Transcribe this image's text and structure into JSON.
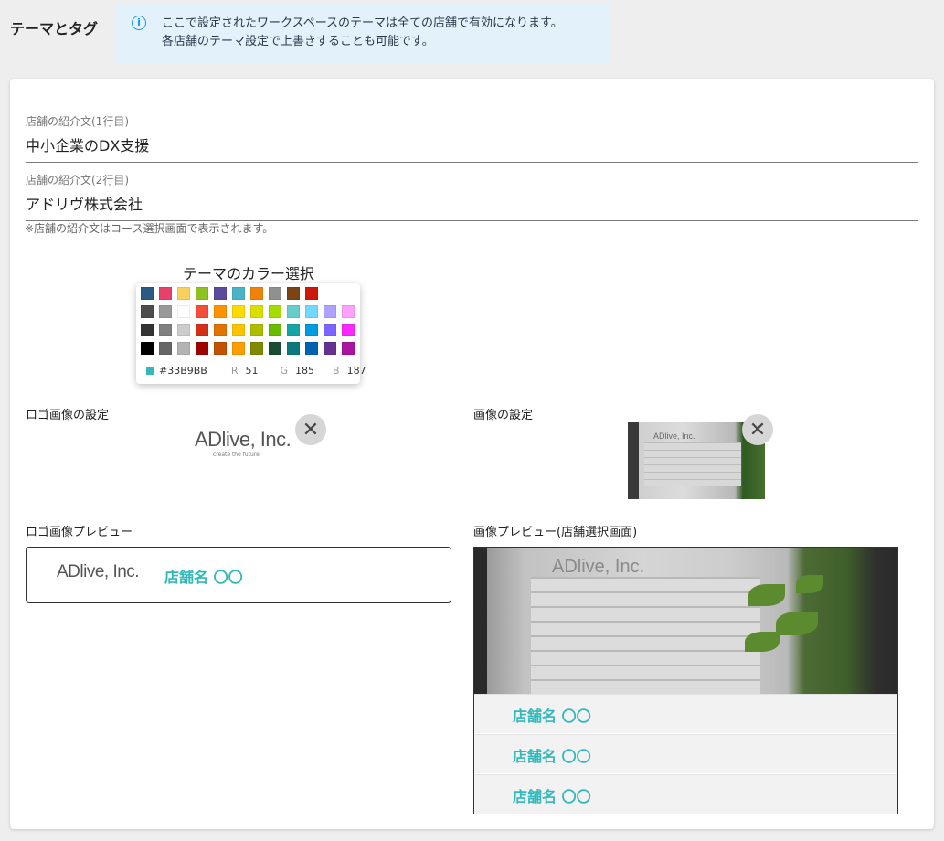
{
  "section": {
    "title": "テーマとタグ"
  },
  "info": {
    "line1": "ここで設定されたワークスペースのテーマは全ての店舗で有効になります。",
    "line2": "各店舗のテーマ設定で上書きすることも可能です。",
    "icon": "info-icon"
  },
  "intro1": {
    "label": "店舗の紹介文(1行目)",
    "value": "中小企業のDX支援"
  },
  "intro2": {
    "label": "店舗の紹介文(2行目)",
    "value": "アドリヴ株式会社"
  },
  "intro_note": "※店舗の紹介文はコース選択画面で表示されます。",
  "theme_color": {
    "title": "テーマのカラー選択",
    "selected_hex": "#33B9BB",
    "r_label": "R",
    "r": "51",
    "g_label": "G",
    "g": "185",
    "b_label": "B",
    "b": "187",
    "palette": [
      [
        "#2a5a84",
        "#e8406c",
        "#f8d15c",
        "#8dc21f",
        "#5c4a9c",
        "#4bb3c8",
        "#f0820a",
        "#909090",
        "#7a4415",
        "#cc1a0a"
      ],
      [
        "#4d4d4d",
        "#999999",
        "#ffffff",
        "#f44e3b",
        "#fe9200",
        "#fcdc00",
        "#dbdf00",
        "#a4dd00",
        "#68ccca",
        "#73d8ff",
        "#aea1ff",
        "#fda1ff"
      ],
      [
        "#333333",
        "#808080",
        "#cccccc",
        "#d33115",
        "#e27300",
        "#fcc400",
        "#b0bc00",
        "#68bc00",
        "#16a5a5",
        "#009ce0",
        "#7b64ff",
        "#fa28ff"
      ],
      [
        "#000000",
        "#666666",
        "#b3b3b3",
        "#9f0500",
        "#c45100",
        "#fb9e00",
        "#808900",
        "#194d33",
        "#0c797d",
        "#0062b1",
        "#653294",
        "#ab149e"
      ]
    ]
  },
  "logo_setting": {
    "label": "ロゴ画像の設定",
    "logo_text": "ADlive, Inc.",
    "logo_sub": "create the future"
  },
  "image_setting": {
    "label": "画像の設定"
  },
  "logo_preview": {
    "label": "ロゴ画像プレビュー",
    "store_name": "店舗名 〇〇"
  },
  "image_preview": {
    "label": "画像プレビュー(店舗選択画面)",
    "sign_text": "ADlive, Inc.",
    "items": [
      "店舗名 〇〇",
      "店舗名 〇〇",
      "店舗名 〇〇"
    ]
  },
  "accent_color": "#33b9bb"
}
